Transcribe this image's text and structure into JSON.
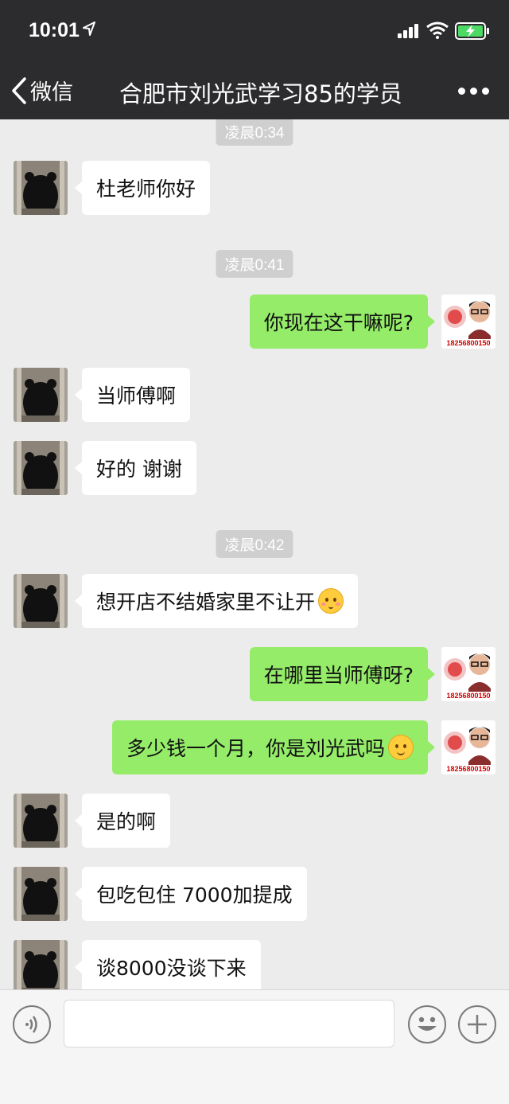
{
  "status": {
    "time": "10:01"
  },
  "nav": {
    "back_label": "微信",
    "title": "合肥市刘光武学习85的学员"
  },
  "messages": {
    "ts1": "凌晨0:34",
    "m1": "杜老师你好",
    "ts2": "凌晨0:41",
    "m2": "你现在这干嘛呢?",
    "m3": "当师傅啊",
    "m4": "好的 谢谢",
    "ts3": "凌晨0:42",
    "m5": "想开店不结婚家里不让开",
    "m6": "在哪里当师傅呀?",
    "m7": "多少钱一个月，你是刘光武吗",
    "m8": "是的啊",
    "m9": "包吃包住 7000加提成",
    "m10": "谈8000没谈下来"
  },
  "contact_avatar": {
    "icon": "kumamon-silhouette-icon"
  },
  "self_avatar": {
    "phone": "18256800150"
  },
  "input": {
    "placeholder": ""
  },
  "colors": {
    "bubble_out": "#95ec69",
    "bubble_in": "#ffffff",
    "nav_bg": "#2c2c2e",
    "chat_bg": "#ececec"
  }
}
